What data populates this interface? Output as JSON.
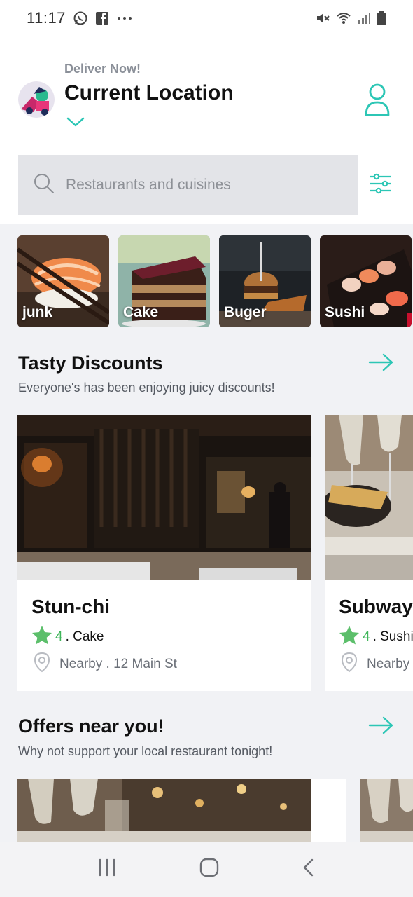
{
  "status_bar": {
    "time": "11:17",
    "left_icons": [
      "whatsapp-icon",
      "facebook-icon",
      "more-dots-icon"
    ],
    "right_icons": [
      "mute-icon",
      "wifi-icon",
      "signal-icon",
      "battery-icon"
    ]
  },
  "header": {
    "deliver_label": "Deliver Now!",
    "location_title": "Current Location"
  },
  "search": {
    "placeholder": "Restaurants and cuisines"
  },
  "categories": [
    {
      "label": "junk"
    },
    {
      "label": "Cake"
    },
    {
      "label": "Buger"
    },
    {
      "label": "Sushi"
    }
  ],
  "tasty_discounts": {
    "title": "Tasty Discounts",
    "subtitle": "Everyone's has been enjoying juicy discounts!",
    "cards": [
      {
        "name": "Stun-chi",
        "rating": "4",
        "category": ". Cake",
        "location": "Nearby . 12 Main St"
      },
      {
        "name": "Subway",
        "rating": "4",
        "category": ". Sushi",
        "location": "Nearby"
      }
    ]
  },
  "offers": {
    "title": "Offers near you!",
    "subtitle": "Why not support your local restaurant tonight!"
  },
  "colors": {
    "accent": "#2cc6b5",
    "star": "#5cbf6b",
    "rating_text": "#3fb55a",
    "background": "#f1f2f5"
  },
  "nav_bar": {
    "icons": [
      "recent-apps-icon",
      "home-icon",
      "back-icon"
    ]
  }
}
